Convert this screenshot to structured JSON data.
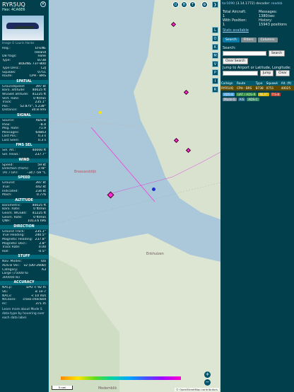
{
  "detail": {
    "callsign": "RYR5UQ",
    "hex_label": "Hex:",
    "hex": "4CA6E6",
    "photo_credit": "Image © Laurin Hanke",
    "info": [
      [
        "Reg.:",
        "EI-ENE"
      ],
      [
        "",
        "Ireland"
      ],
      [
        "DB flags:",
        "none"
      ],
      [
        "Type:",
        "B738"
      ],
      [
        "",
        "BOEING 737-800"
      ],
      [
        "Type Desc.:",
        "L2J"
      ],
      [
        "Squawk:",
        "0751"
      ],
      [
        "Route:",
        "CPH - BRS"
      ]
    ],
    "spatial_title": "SPATIAL",
    "spatial": [
      [
        "Groundspeed:",
        "397 kt"
      ],
      [
        "Baro. altitude:",
        "40025 ft"
      ],
      [
        "WGS84 altitude:",
        "41225 ft"
      ],
      [
        "Vert. Rate:",
        "0 ft/min"
      ],
      [
        "Track:",
        "235.1°"
      ],
      [
        "Pos.:",
        "52.875°, 5.238°"
      ],
      [
        "Distance:",
        "30.8 nmi"
      ]
    ],
    "signal_title": "SIGNAL",
    "signal": [
      [
        "Source:",
        "ADS-B"
      ],
      [
        "RSSI:",
        "-8.4"
      ],
      [
        "Msg. Rate:",
        "71.9"
      ],
      [
        "Messages:",
        "64843"
      ],
      [
        "Last Pos.:",
        "0.3 s"
      ],
      [
        "Last Seen:",
        "0.3 s"
      ]
    ],
    "fms_title": "FMS SEL",
    "fms": [
      [
        "Sel. Alt.:",
        "40000 ft"
      ],
      [
        "Sel. Head.:",
        "237.7°"
      ]
    ],
    "wind_title": "WIND",
    "wind": [
      [
        "Speed:",
        "59 kt"
      ],
      [
        "Direction (from):",
        "278°"
      ],
      [
        "TAT / OAT:",
        "-34 / -59 °C"
      ]
    ],
    "speed_title": "SPEED",
    "speed": [
      [
        "Ground:",
        "397 kt"
      ],
      [
        "True:",
        "442 kt"
      ],
      [
        "Indicated:",
        "234 kt"
      ],
      [
        "Mach:",
        "0.776"
      ]
    ],
    "altitude_title": "ALTITUDE",
    "altitude": [
      [
        "Barometric:",
        "40025 ft"
      ],
      [
        "Baro. Rate:",
        "0 ft/min"
      ],
      [
        "Geom. WGS84:",
        "41225 ft"
      ],
      [
        "Geom. Rate:",
        "0 ft/min"
      ],
      [
        "QNH:",
        "1013.6 hPa"
      ]
    ],
    "direction_title": "DIRECTION",
    "direction": [
      [
        "Ground Track:",
        "235.1°"
      ],
      [
        "True Heading:",
        "240.5°"
      ],
      [
        "Magnetic Heading:",
        "237.8°"
      ],
      [
        "Magnetic Decl.:",
        "2.8°"
      ],
      [
        "Track Rate:",
        "0.00"
      ],
      [
        "Roll:",
        "-0.5°"
      ]
    ],
    "stuff_title": "STUFF",
    "stuff": [
      [
        "Nav. Modes:",
        "n/a"
      ],
      [
        "ADS-B Ver.:",
        "v2 (DO-260B)"
      ],
      [
        "Category:",
        "A3"
      ],
      [
        "Large (75000 to",
        ""
      ],
      [
        "300000 lb)",
        ""
      ]
    ],
    "accuracy_title": "ACCURACY",
    "accuracy": [
      [
        "NACp:",
        "EPU < 92 m"
      ],
      [
        "SIL:",
        "≤ 1e-7"
      ],
      [
        "NACv:",
        "< 10 m/s"
      ],
      [
        "NICbaro:",
        "cross-checked"
      ],
      [
        "Rc:",
        "371 m"
      ]
    ],
    "footer_note": "Learn more about Mode S data type by hovering over each data label."
  },
  "map": {
    "labels": {
      "place1": "Breezanddijk",
      "place2": "Enkhuizen",
      "place3": "Medemblik"
    },
    "buttons": [
      "U",
      "H",
      "T"
    ],
    "side_buttons": [
      "L",
      "O",
      "K",
      "M",
      "V",
      "P",
      "I",
      "R"
    ],
    "zoom_in": "+",
    "zoom_out": "−",
    "scale": "5 nmi",
    "attribution": "© OpenStreetMap contributors"
  },
  "panel": {
    "link": "tar1090",
    "version": "(3.14.1772)",
    "decoder_label": "decoder:",
    "decoder": "readsb",
    "total_label": "Total Aircraft:",
    "total": "1",
    "messages_label": "Messages:",
    "messages": "1380/sec",
    "with_pos_label": "With Position:",
    "with_pos": "1",
    "history_label": "History:",
    "history": "15943 positions",
    "stats_label": "Stats available",
    "tabs": [
      "Search",
      "Filters",
      "Columns"
    ],
    "search_label": "Search:",
    "search_button": "Search",
    "clear_search": "Clear Search",
    "jump_label": "Jump to Airport or Latitude, Longitude:",
    "jump_button": "Jump",
    "clear_button": "Clear",
    "columns": [
      "Callsign",
      "Route",
      "Type",
      "Squawk",
      "Alt. (ft)"
    ],
    "row": [
      "RYR5UQ",
      "CPH - BRS",
      "B738",
      "0751",
      "40025"
    ],
    "badges": [
      [
        "ADS-B",
        "#4aa3df"
      ],
      [
        "UAT / ADS-R",
        "#2f8f3a"
      ],
      [
        "MLAT",
        "#d4b200"
      ],
      [
        "TIS-B",
        "#c04030"
      ],
      [
        "Mode-S",
        "#7a8ea0"
      ],
      [
        "AIS",
        "#2a6a8a"
      ],
      [
        "ADS-C",
        "#3d8f6a"
      ]
    ]
  },
  "colors": {
    "panel_bg": "#003f4b",
    "section_bg": "#006a7a",
    "aircraft": "#ff2bd6",
    "selected_row": "#5d4a00"
  }
}
